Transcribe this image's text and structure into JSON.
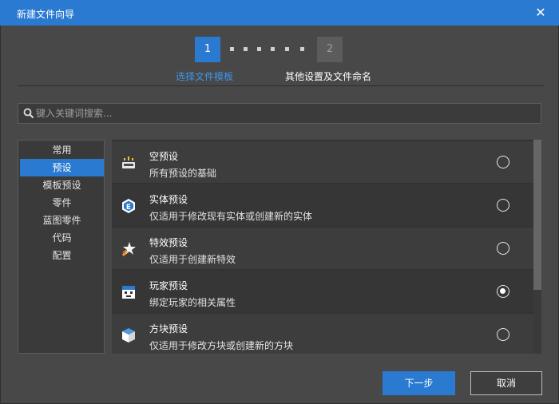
{
  "window": {
    "title": "新建文件向导",
    "close_glyph": "✕"
  },
  "wizard": {
    "steps": [
      {
        "number": "1",
        "label": "选择文件模板"
      },
      {
        "number": "2",
        "label": "其他设置及文件命名"
      }
    ]
  },
  "search": {
    "placeholder": "键入关键词搜索...",
    "value": ""
  },
  "sidebar": {
    "items": [
      {
        "label": "常用"
      },
      {
        "label": "预设"
      },
      {
        "label": "模板预设"
      },
      {
        "label": "零件"
      },
      {
        "label": "蓝图零件"
      },
      {
        "label": "代码"
      },
      {
        "label": "配置"
      }
    ],
    "selected": "预设"
  },
  "templates": [
    {
      "title": "空预设",
      "description": "所有预设的基础",
      "icon": "empty-preset-icon",
      "selected": false
    },
    {
      "title": "实体预设",
      "description": "仅适用于修改现有实体或创建新的实体",
      "icon": "entity-preset-icon",
      "selected": false
    },
    {
      "title": "特效预设",
      "description": "仅适用于创建新特效",
      "icon": "effect-preset-icon",
      "selected": false
    },
    {
      "title": "玩家预设",
      "description": "绑定玩家的相关属性",
      "icon": "player-preset-icon",
      "selected": true
    },
    {
      "title": "方块预设",
      "description": "仅适用于修改方块或创建新的方块",
      "icon": "block-preset-icon",
      "selected": false
    }
  ],
  "buttons": {
    "next": "下一步",
    "cancel": "取消"
  },
  "colors": {
    "accent": "#2b7ad2",
    "background": "#484848",
    "active_step_label": "#3f95ea"
  }
}
